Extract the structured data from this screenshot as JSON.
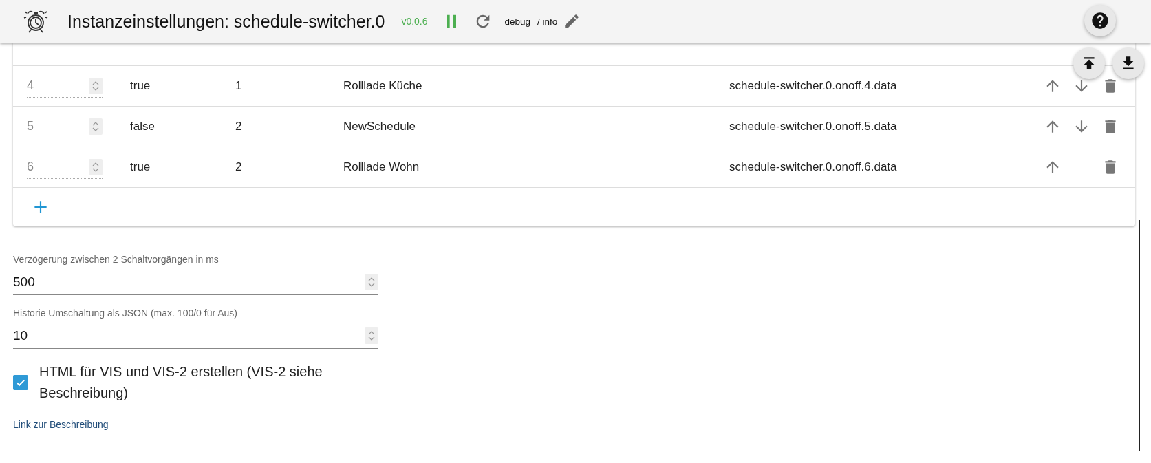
{
  "header": {
    "title": "Instanzeinstellungen: schedule-switcher.0",
    "version": "v0.0.6",
    "running": true,
    "log_level": "debug",
    "log_suffix": "/ info"
  },
  "table": {
    "rows": [
      {
        "column_1": "4",
        "column_2": "true",
        "column_3": "1",
        "column_4": "Rolllade Küche",
        "column_5": "schedule-switcher.0.onoff.4.data",
        "move_up": true,
        "move_down": true
      },
      {
        "column_1": "5",
        "column_2": "false",
        "column_3": "2",
        "column_4": "NewSchedule",
        "column_5": "schedule-switcher.0.onoff.5.data",
        "move_up": true,
        "move_down": true
      },
      {
        "column_1": "6",
        "column_2": "true",
        "column_3": "2",
        "column_4": "Rolllade Wohn",
        "column_5": "schedule-switcher.0.onoff.6.data",
        "move_up": true,
        "move_down": false
      }
    ]
  },
  "fields": [
    {
      "label": "Verzögerung zwischen 2 Schaltvorgängen in ms",
      "value": "500"
    },
    {
      "label": "Historie Umschaltung als JSON (max. 100/0 für Aus)",
      "value": "10"
    }
  ],
  "checkbox": {
    "label": "HTML für VIS und VIS-2 erstellen (VIS-2 siehe Beschreibung)",
    "checked": true
  },
  "link": "Link zur Beschreibung"
}
